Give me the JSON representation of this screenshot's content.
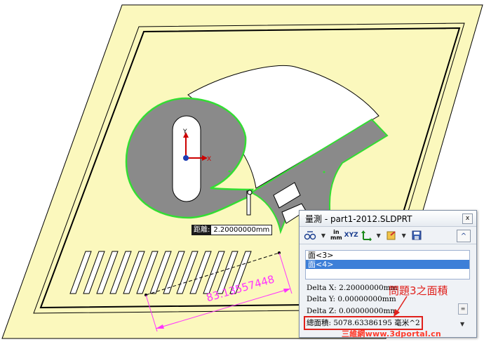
{
  "viewport": {
    "distance_label_key": "距離:",
    "distance_label_value": "2.20000000mm",
    "dimension_value": "83.13557448",
    "triad_y": "Y",
    "triad_x": "X"
  },
  "measure_dialog": {
    "title": "量測 - part1-2012.SLDPRT",
    "close_label": "x",
    "toolbar": {
      "units_in": "in",
      "units_mm": "mm",
      "xyz": "XYZ",
      "collapse": "^"
    },
    "selections": [
      "面<3>",
      "面<4>"
    ],
    "selected_index": 1,
    "results": {
      "delta_x": "Delta X: 2.20000000mm",
      "delta_y": "Delta Y: 0.00000000mm",
      "delta_z": "Delta Z: 0.00000000mm",
      "total_area": "總面積: 5078.63386195 毫米^2"
    }
  },
  "annotation": "問題3之面積",
  "watermark": "三維網www.3dportal.cn",
  "colors": {
    "sheet": "#fbf8bd",
    "highlight": "#33dd33",
    "face": "#8a8a8a",
    "dimension": "#ff33ff",
    "annotation": "#e0201b"
  }
}
